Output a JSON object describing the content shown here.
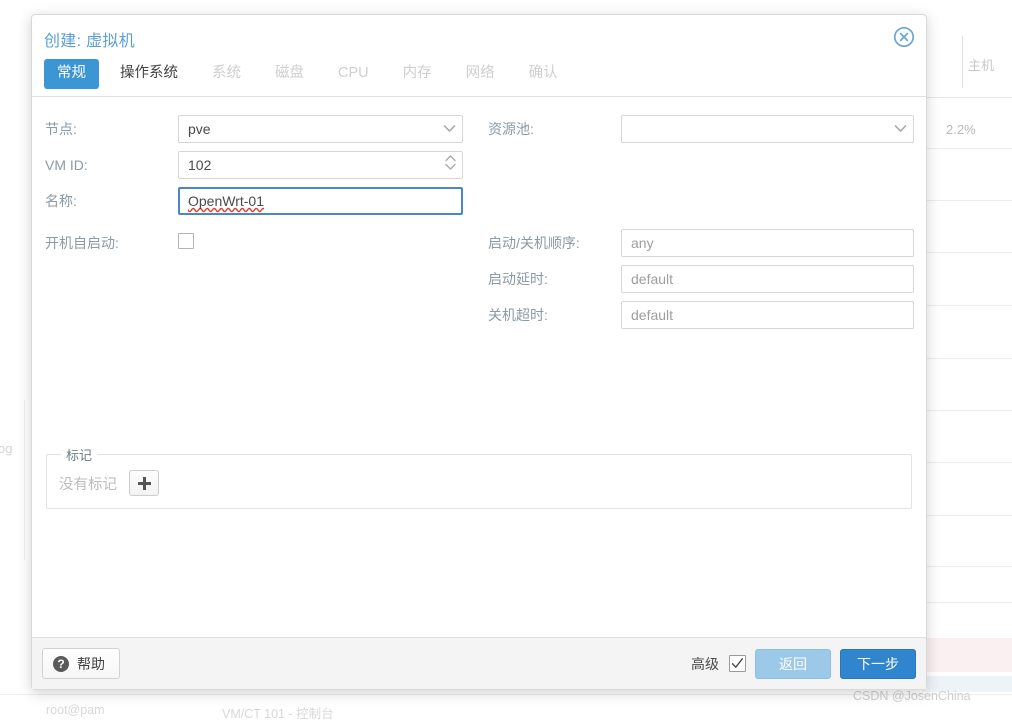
{
  "background": {
    "table_header": "主机",
    "cpu_value": "2.2%",
    "left_fragment": "og",
    "status_user": "root@pam",
    "status_task": "VM/CT 101 - 控制台",
    "watermark": "CSDN @JosenChina"
  },
  "dialog": {
    "title": "创建: 虚拟机",
    "close_icon": "close-circle-icon",
    "tabs": [
      {
        "label": "常规",
        "state": "active"
      },
      {
        "label": "操作系统",
        "state": "enabled"
      },
      {
        "label": "系统",
        "state": "disabled"
      },
      {
        "label": "磁盘",
        "state": "disabled"
      },
      {
        "label": "CPU",
        "state": "disabled"
      },
      {
        "label": "内存",
        "state": "disabled"
      },
      {
        "label": "网络",
        "state": "disabled"
      },
      {
        "label": "确认",
        "state": "disabled"
      }
    ],
    "fields": {
      "node": {
        "label": "节点:",
        "value": "pve",
        "type": "combobox"
      },
      "vmid": {
        "label": "VM ID:",
        "value": "102",
        "type": "spinner"
      },
      "name": {
        "label": "名称:",
        "value": "OpenWrt-01",
        "type": "text",
        "focused": true,
        "spellcheck_flagged": true
      },
      "pool": {
        "label": "资源池:",
        "value": "",
        "type": "combobox"
      },
      "start_at_boot": {
        "label": "开机自启动:",
        "value": "",
        "checked": false,
        "type": "checkbox"
      },
      "start_order": {
        "label": "启动/关机顺序:",
        "value": "any",
        "type": "text"
      },
      "startup_delay": {
        "label": "启动延时:",
        "value": "default",
        "type": "text"
      },
      "shutdown_timeout": {
        "label": "关机超时:",
        "value": "default",
        "type": "text"
      }
    },
    "tags": {
      "legend": "标记",
      "empty_text": "没有标记",
      "add_icon": "plus-icon"
    },
    "footer": {
      "help_label": "帮助",
      "help_icon": "question-circle-icon",
      "advanced_label": "高级",
      "advanced_checked": true,
      "back_label": "返回",
      "next_label": "下一步"
    },
    "colors": {
      "accent": "#3c96d4",
      "title": "#5a9fd4",
      "primary_button": "#2f86ce",
      "disabled_button": "#9cc9e8",
      "focus_border": "#4a86c8",
      "spellcheck": "#e33b2e"
    }
  }
}
